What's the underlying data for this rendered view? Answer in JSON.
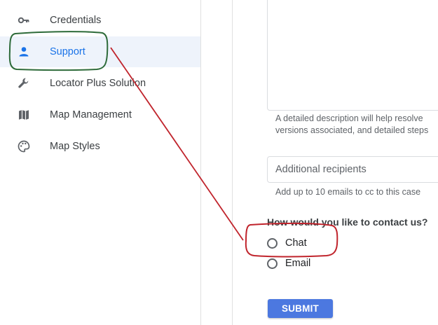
{
  "sidebar": {
    "items": [
      {
        "label": "Credentials",
        "icon": "key-icon"
      },
      {
        "label": "Support",
        "icon": "person-icon",
        "active": true
      },
      {
        "label": "Locator Plus Solution",
        "icon": "wrench-icon"
      },
      {
        "label": "Map Management",
        "icon": "map-icon"
      },
      {
        "label": "Map Styles",
        "icon": "palette-icon"
      }
    ]
  },
  "form": {
    "description_helper_line1": "A detailed description will help resolve",
    "description_helper_line2": "versions associated, and detailed steps",
    "recipients_placeholder": "Additional recipients",
    "recipients_helper": "Add up to 10 emails to cc to this case",
    "contact_question": "How would you like to contact us?",
    "contact_options": [
      "Chat",
      "Email"
    ],
    "submit_label": "SUBMIT"
  },
  "colors": {
    "accent": "#1a73e8",
    "submit_button": "#4c78e0",
    "annotation_red": "#c0242c",
    "annotation_green": "#2e6b3a",
    "active_nav_bg": "#eef3fb"
  }
}
